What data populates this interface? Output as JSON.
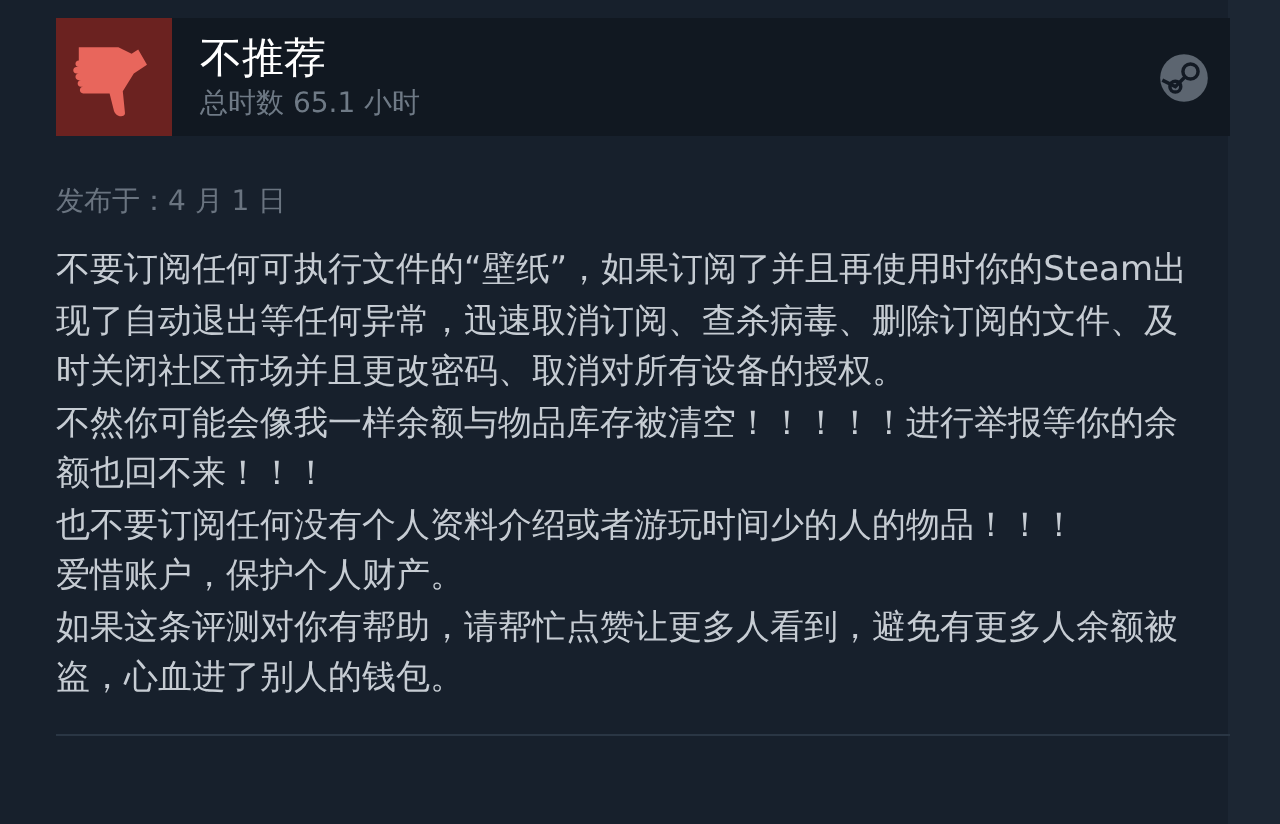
{
  "review": {
    "recommended": false,
    "verdict": "不推荐",
    "hours": "总时数 65.1 小时",
    "posted": "发布于：4 月 1 日",
    "paragraphs": [
      "不要订阅任何可执行文件的“壁纸”，如果订阅了并且再使用时你的Steam出现了自动退出等任何异常，迅速取消订阅、查杀病毒、删除订阅的文件、及时关闭社区市场并且更改密码、取消对所有设备的授权。",
      "不然你可能会像我一样余额与物品库存被清空！！！！！进行举报等你的余额也回不来！！！",
      "也不要订阅任何没有个人资料介绍或者游玩时间少的人的物品！！！",
      "爱惜账户，保护个人财产。",
      "如果这条评测对你有帮助，请帮忙点赞让更多人看到，避免有更多人余额被盗，心血进了别人的钱包。"
    ]
  }
}
